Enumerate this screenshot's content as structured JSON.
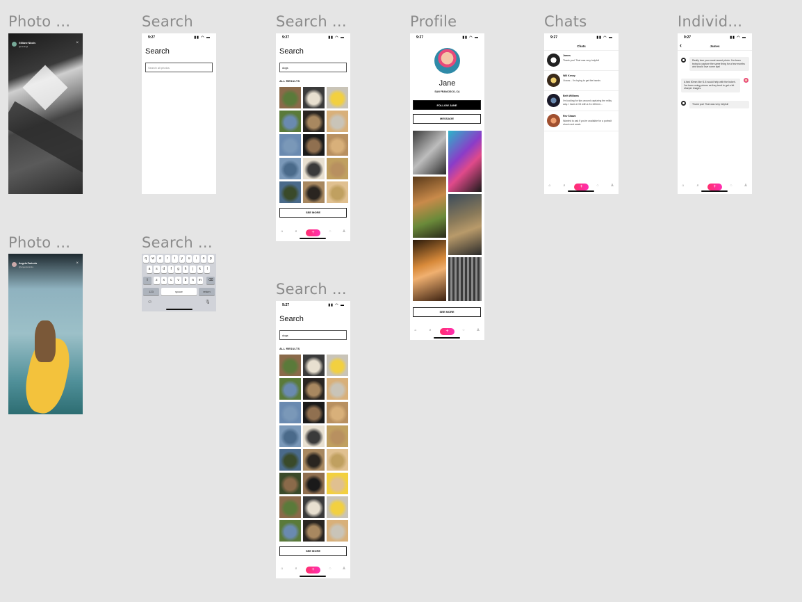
{
  "frames": {
    "photo1": "Photo ...",
    "photo2": "Photo ...",
    "search": "Search",
    "search_kb": "Search ...",
    "search_res": "Search ...",
    "search_res2": "Search ...",
    "profile": "Profile",
    "chats": "Chats",
    "individual": "Individ..."
  },
  "status": {
    "time": "9:27",
    "icons": "▮▮ ◠ ▬"
  },
  "photo_viewer": {
    "user1_name": "Gilliane Nicols",
    "user1_handle": "@nicolsgi",
    "user2_name": "Angela Paricela",
    "user2_handle": "@angelparicela",
    "close": "×"
  },
  "search": {
    "title": "Search",
    "placeholder": "Search all photos",
    "query": "dogs",
    "results_label": "ALL RESULTS",
    "see_more": "SEE MORE"
  },
  "keyboard": {
    "row1": [
      "q",
      "w",
      "e",
      "r",
      "t",
      "y",
      "u",
      "i",
      "o",
      "p"
    ],
    "row2": [
      "a",
      "s",
      "d",
      "f",
      "g",
      "h",
      "j",
      "k",
      "l"
    ],
    "row3": [
      "z",
      "x",
      "c",
      "v",
      "b",
      "n",
      "m"
    ],
    "shift": "⇧",
    "backspace": "⌫",
    "num": "123",
    "space": "space",
    "return": "return",
    "emoji": "☺",
    "mic": "🎙"
  },
  "profile": {
    "name": "Jane",
    "location": "SAN FRANCISCO, CA",
    "follow": "FOLLOW JANE",
    "message": "MESSAGE",
    "see_more": "SEE MORE"
  },
  "chats": {
    "title": "Chats",
    "rows": [
      {
        "name": "James",
        "msg": "Thank you! That was very helpful!"
      },
      {
        "name": "Will Kenny",
        "msg": "I know... I'm trying to get the bands"
      },
      {
        "name": "Beth Williams",
        "msg": "I'm looking for tips around capturing the milky way. I have a DS with a 24-100mm..."
      },
      {
        "name": "Rev Shawn",
        "msg": "Wanted to ask if you're available for a portrait shoot next week."
      }
    ]
  },
  "individual": {
    "title": "James",
    "back": "‹",
    "messages": [
      "Really love your most recent photo. I've been trying to capture the same thing for a few months and would love some tips!",
      "A fast 50mm like f1.8 would help with the bokeh. I've been using primes as they tend to get a bit sharper images.",
      "Thank you! That was very helpful!"
    ]
  },
  "tabbar": {
    "home": "⌂",
    "search": "⌕",
    "add": "+",
    "chat": "◌",
    "profile": "♙"
  },
  "colors": {
    "accent": "#ff2f8a",
    "bg": "#e5e5e5"
  }
}
